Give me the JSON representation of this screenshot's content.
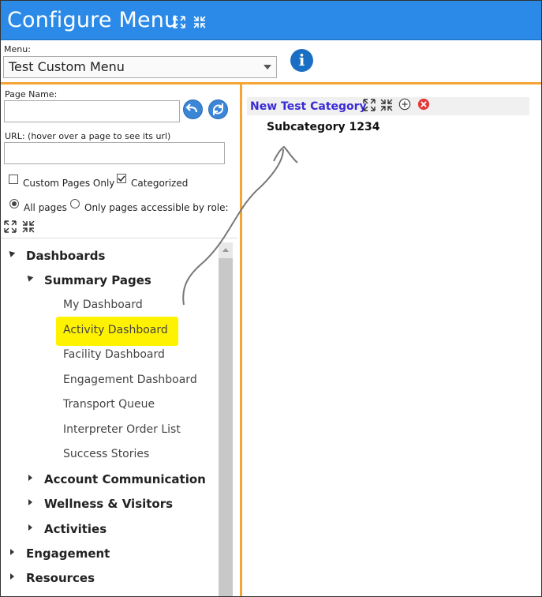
{
  "header": {
    "title": "Configure Menu",
    "expand_icon": "expand-icon",
    "collapse_icon": "collapse-icon"
  },
  "menu": {
    "label": "Menu:",
    "selected": "Test Custom Menu",
    "info_icon": "i"
  },
  "left": {
    "page_name_label": "Page Name:",
    "page_name_value": "",
    "url_label": "URL: (hover over a page to see its url)",
    "url_value": "",
    "custom_pages_only": {
      "label": "Custom Pages Only",
      "checked": false
    },
    "categorized": {
      "label": "Categorized",
      "checked": true
    },
    "all_pages": {
      "label": "All pages",
      "selected": true
    },
    "role_pages": {
      "label": "Only pages accessible by role:",
      "selected": false
    }
  },
  "tree": {
    "dashboards": "Dashboards",
    "summary_pages": "Summary Pages",
    "leaves": [
      "My Dashboard",
      "Activity Dashboard",
      "Facility Dashboard",
      "Engagement Dashboard",
      "Transport Queue",
      "Interpreter Order List",
      "Success Stories"
    ],
    "account_communication": "Account Communication",
    "wellness_visitors": "Wellness & Visitors",
    "activities": "Activities",
    "engagement": "Engagement",
    "resources": "Resources"
  },
  "right": {
    "category": "New Test Category",
    "subcategory": "Subcategory 1234"
  },
  "colors": {
    "header_bg": "#2b8ae8",
    "accent": "#f5a533",
    "category": "#3a2bd6",
    "highlight": "#fff200"
  }
}
